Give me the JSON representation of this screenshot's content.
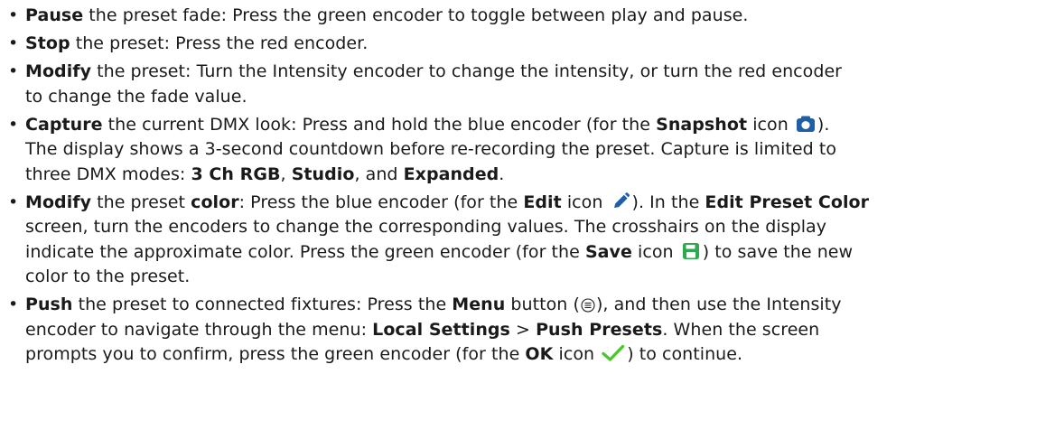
{
  "items": [
    {
      "segments": [
        {
          "t": "Pause",
          "b": true
        },
        {
          "t": " the preset fade: Press the green encoder to toggle between play and pause."
        }
      ]
    },
    {
      "segments": [
        {
          "t": "Stop",
          "b": true
        },
        {
          "t": " the preset: Press the red encoder."
        }
      ]
    },
    {
      "segments": [
        {
          "t": "Modify",
          "b": true
        },
        {
          "t": " the preset: Turn the Intensity encoder to change the intensity, or turn the red encoder"
        },
        {
          "br": true
        },
        {
          "t": "to change the fade value."
        }
      ]
    },
    {
      "segments": [
        {
          "t": "Capture",
          "b": true
        },
        {
          "t": " the current DMX look: Press and hold the blue encoder (for the "
        },
        {
          "t": "Snapshot",
          "b": true
        },
        {
          "t": " icon "
        },
        {
          "icon": "camera-icon"
        },
        {
          "t": ")."
        },
        {
          "br": true
        },
        {
          "t": "The display shows a 3-second countdown before re-recording the preset. Capture is limited to"
        },
        {
          "br": true
        },
        {
          "t": "three DMX modes: "
        },
        {
          "t": "3 Ch RGB",
          "b": true
        },
        {
          "t": ", "
        },
        {
          "t": "Studio",
          "b": true
        },
        {
          "t": ", and "
        },
        {
          "t": "Expanded",
          "b": true
        },
        {
          "t": "."
        }
      ]
    },
    {
      "segments": [
        {
          "t": "Modify",
          "b": true
        },
        {
          "t": " the preset "
        },
        {
          "t": "color",
          "b": true
        },
        {
          "t": ": Press the blue encoder (for the "
        },
        {
          "t": "Edit",
          "b": true
        },
        {
          "t": " icon "
        },
        {
          "icon": "pencil-icon"
        },
        {
          "t": "). In the "
        },
        {
          "t": "Edit Preset Color",
          "b": true
        },
        {
          "br": true
        },
        {
          "t": "screen, turn the encoders to change the corresponding values. The crosshairs on the display"
        },
        {
          "br": true
        },
        {
          "t": "indicate the approximate color. Press the green encoder (for the "
        },
        {
          "t": "Save",
          "b": true
        },
        {
          "t": " icon "
        },
        {
          "icon": "save-icon"
        },
        {
          "t": ") to save the new"
        },
        {
          "br": true
        },
        {
          "t": "color to the preset."
        }
      ]
    },
    {
      "segments": [
        {
          "t": "Push",
          "b": true
        },
        {
          "t": " the preset to connected fixtures: Press the "
        },
        {
          "t": "Menu",
          "b": true
        },
        {
          "t": " button ("
        },
        {
          "icon": "menu-icon"
        },
        {
          "t": "), and then use the Intensity"
        },
        {
          "br": true
        },
        {
          "t": "encoder to navigate through the menu: "
        },
        {
          "t": "Local Settings",
          "b": true
        },
        {
          "t": " > "
        },
        {
          "t": "Push Presets",
          "b": true
        },
        {
          "t": ". When the screen"
        },
        {
          "br": true
        },
        {
          "t": "prompts you to confirm, press the green encoder (for the "
        },
        {
          "t": "OK",
          "b": true
        },
        {
          "t": " icon "
        },
        {
          "icon": "checkmark-icon"
        },
        {
          "t": ") to continue."
        }
      ]
    }
  ],
  "colors": {
    "text": "#1a1a1a",
    "camera_icon": "#1f5fa8",
    "pencil_icon": "#1f5fa8",
    "save_icon": "#2fa84f",
    "check_icon": "#4cc62e"
  }
}
